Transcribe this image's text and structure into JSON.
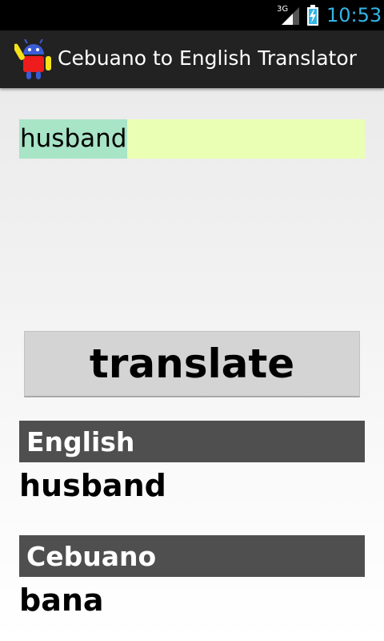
{
  "status_bar": {
    "network": "3G",
    "time": "10:53",
    "time_color": "#33b5e5",
    "icons": [
      "signal-icon",
      "battery-charging-icon"
    ]
  },
  "action_bar": {
    "app_icon": "android-robot-icon",
    "title": "Cebuano to English Translator"
  },
  "input": {
    "value": "husband",
    "background": "#eaffb3",
    "selection_highlight": "#a8e4c6"
  },
  "translate_button": {
    "label": "translate"
  },
  "results": {
    "english_header": "English",
    "english_value": "husband",
    "cebuano_header": "Cebuano",
    "cebuano_value": "bana",
    "header_background": "#4f4f4f"
  }
}
